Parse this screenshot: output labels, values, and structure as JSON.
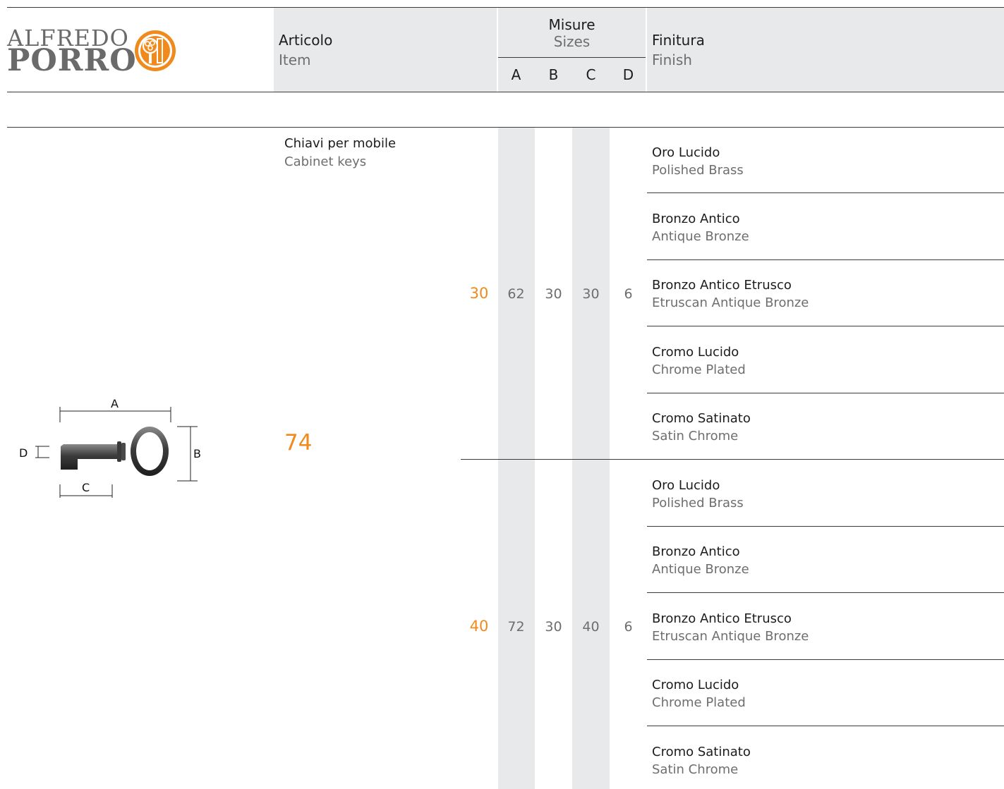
{
  "brand": {
    "line1": "ALFREDO",
    "line2": "PORRO"
  },
  "header": {
    "item_it": "Articolo",
    "item_en": "Item",
    "sizes_it": "Misure",
    "sizes_en": "Sizes",
    "size_letters": [
      "A",
      "B",
      "C",
      "D"
    ],
    "finish_it": "Finitura",
    "finish_en": "Finish"
  },
  "product": {
    "name_it": "Chiavi per mobile",
    "name_en": "Cabinet keys",
    "code": "74",
    "diagram_labels": {
      "a": "A",
      "b": "B",
      "c": "C",
      "d": "D"
    }
  },
  "variants": [
    {
      "size": "30",
      "dims": [
        "62",
        "30",
        "30",
        "6"
      ],
      "finishes": [
        {
          "it": "Oro Lucido",
          "en": "Polished Brass"
        },
        {
          "it": "Bronzo Antico",
          "en": "Antique Bronze"
        },
        {
          "it": "Bronzo Antico Etrusco",
          "en": "Etruscan Antique Bronze"
        },
        {
          "it": "Cromo Lucido",
          "en": "Chrome Plated"
        },
        {
          "it": "Cromo Satinato",
          "en": "Satin Chrome"
        }
      ]
    },
    {
      "size": "40",
      "dims": [
        "72",
        "30",
        "40",
        "6"
      ],
      "finishes": [
        {
          "it": "Oro Lucido",
          "en": "Polished Brass"
        },
        {
          "it": "Bronzo Antico",
          "en": "Antique Bronze"
        },
        {
          "it": "Bronzo Antico Etrusco",
          "en": "Etruscan Antique Bronze"
        },
        {
          "it": "Cromo Lucido",
          "en": "Chrome Plated"
        },
        {
          "it": "Cromo Satinato",
          "en": "Satin Chrome"
        }
      ]
    }
  ],
  "colors": {
    "accent": "#f08a1c",
    "band": "#e8e9eb",
    "rule": "#3a3a3a"
  }
}
